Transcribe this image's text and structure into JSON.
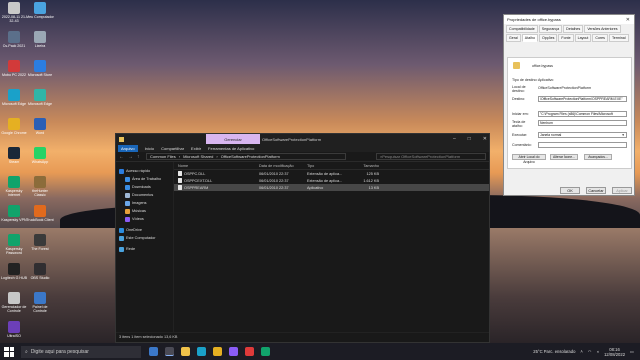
{
  "desktop": {
    "icons": [
      {
        "label": "2022-08-11 21-32-43",
        "color": "#c8c8c8"
      },
      {
        "label": "Meu Computador",
        "color": "#4aa3df"
      },
      {
        "label": "Cs-Pack 2021",
        "color": "#5b6f8a"
      },
      {
        "label": "Lixeira",
        "color": "#9aa7b4"
      },
      {
        "label": "Mobo PC 2022",
        "color": "#d23a3a"
      },
      {
        "label": "Microsoft Store",
        "color": "#2b7de0"
      },
      {
        "label": "Microsoft Edge",
        "color": "#1aa1c9"
      },
      {
        "label": "Microsoft Edge",
        "color": "#2fb5a7"
      },
      {
        "label": "Google Chrome",
        "color": "#e5b022"
      },
      {
        "label": "Word",
        "color": "#2b5fb5"
      },
      {
        "label": "Steam",
        "color": "#1b2838"
      },
      {
        "label": "WhatsApp",
        "color": "#25d366"
      },
      {
        "label": "Kaspersky Internet",
        "color": "#11a36b"
      },
      {
        "label": "theHunter Classic",
        "color": "#8c6c3a"
      },
      {
        "label": "Kaspersky VPN",
        "color": "#11a36b"
      },
      {
        "label": "TruckBook Client",
        "color": "#e16a1d"
      },
      {
        "label": "Kaspersky Password",
        "color": "#11a36b"
      },
      {
        "label": "The Forest",
        "color": "#3a3a3a"
      },
      {
        "label": "Logitech G HUB",
        "color": "#222222"
      },
      {
        "label": "OBS Studio",
        "color": "#302e31"
      },
      {
        "label": "Gerenciador de Controle",
        "color": "#c7c7c7"
      },
      {
        "label": "Painel de Controle",
        "color": "#3b78c9"
      },
      {
        "label": "UltraISO",
        "color": "#6c3fb8"
      }
    ]
  },
  "explorer": {
    "title": "OfficeSoftwareProtectionPlatform",
    "manage_tab": "Gerenciar",
    "ribbon_tabs": [
      "Arquivo",
      "Início",
      "Compartilhar",
      "Exibir",
      "Ferramentas de Aplicativo"
    ],
    "path": [
      "Common Files",
      "Microsoft Shared",
      "OfficeSoftwareProtectionPlatform"
    ],
    "search_placeholder": "Pesquisar OfficeSoftwareProtectionPlatform",
    "nav": [
      {
        "label": "Acesso rápido",
        "color": "#2b7de0",
        "indent": false
      },
      {
        "label": "Área de Trabalho",
        "color": "#3a8ee6",
        "indent": true
      },
      {
        "label": "Downloads",
        "color": "#3a8ee6",
        "indent": true
      },
      {
        "label": "Documentos",
        "color": "#9fb8d6",
        "indent": true
      },
      {
        "label": "Imagens",
        "color": "#6aa6e8",
        "indent": true
      },
      {
        "label": "Músicas",
        "color": "#e6a03a",
        "indent": true
      },
      {
        "label": "Vídeos",
        "color": "#8b5cf6",
        "indent": true
      },
      {
        "label": "OneDrive",
        "color": "#2b8de0",
        "indent": false
      },
      {
        "label": "Este Computador",
        "color": "#4aa3df",
        "indent": false
      },
      {
        "label": "Rede",
        "color": "#4aa3df",
        "indent": false
      }
    ],
    "columns": [
      "Nome",
      "Data de modificação",
      "Tipo",
      "Tamanho"
    ],
    "files": [
      {
        "name": "OSPPC.DLL",
        "date": "06/01/2010 22:37",
        "type": "Extensão de aplica...",
        "size": "125 KB",
        "selected": false
      },
      {
        "name": "OSPPCEXT.DLL",
        "date": "06/01/2010 22:37",
        "type": "Extensão de aplica...",
        "size": "1.612 KB",
        "selected": false
      },
      {
        "name": "OSPPREARM",
        "date": "06/01/2010 22:37",
        "type": "Aplicativo",
        "size": "13 KB",
        "selected": true
      }
    ],
    "status": "3 itens   1 item selecionado 13,6 KB"
  },
  "dialog": {
    "title": "Propriedades de office.bypass",
    "tabs": [
      "Compatibilidade",
      "Segurança",
      "Detalhes",
      "Versões Anteriores",
      "Geral",
      "Atalho",
      "Opções",
      "Fonte",
      "Layout",
      "Cores",
      "Terminal"
    ],
    "active_tab": "Atalho",
    "shortcut_name": "office.bypass",
    "fields": {
      "target_type_label": "Tipo de destino:",
      "target_type_value": "Aplicativo",
      "target_location_label": "Local de destino:",
      "target_location_value": "OfficeSoftwareProtectionPlatform",
      "target_label": "Destino:",
      "target_value": "\\OfficeSoftwareProtectionPlatform\\OSPPREARM.EXE\"",
      "start_in_label": "Iniciar em:",
      "start_in_value": "\"C:\\Program Files (x86)\\Common Files\\Microsoft",
      "hotkey_label": "Tecla de atalho:",
      "hotkey_value": "Nenhum",
      "run_label": "Executar:",
      "run_value": "Janela normal",
      "comment_label": "Comentário:",
      "comment_value": ""
    },
    "open_location_button": "Abrir Local do Arquivo",
    "change_icon_button": "Alterar Ícone...",
    "advanced_button": "Avançados...",
    "ok_button": "OK",
    "cancel_button": "Cancelar",
    "apply_button": "Aplicar"
  },
  "taskbar": {
    "search_placeholder": "Digite aqui para pesquisar",
    "weather": "25°C  Parc. ensolarado",
    "time": "08:16",
    "date": "12/08/2022",
    "apps": [
      "#3b78c9",
      "#4a4a55",
      "#f0c24a",
      "#1aa1c9",
      "#e5b022",
      "#8b5cf6",
      "#e03a3a",
      "#11a36b"
    ]
  }
}
